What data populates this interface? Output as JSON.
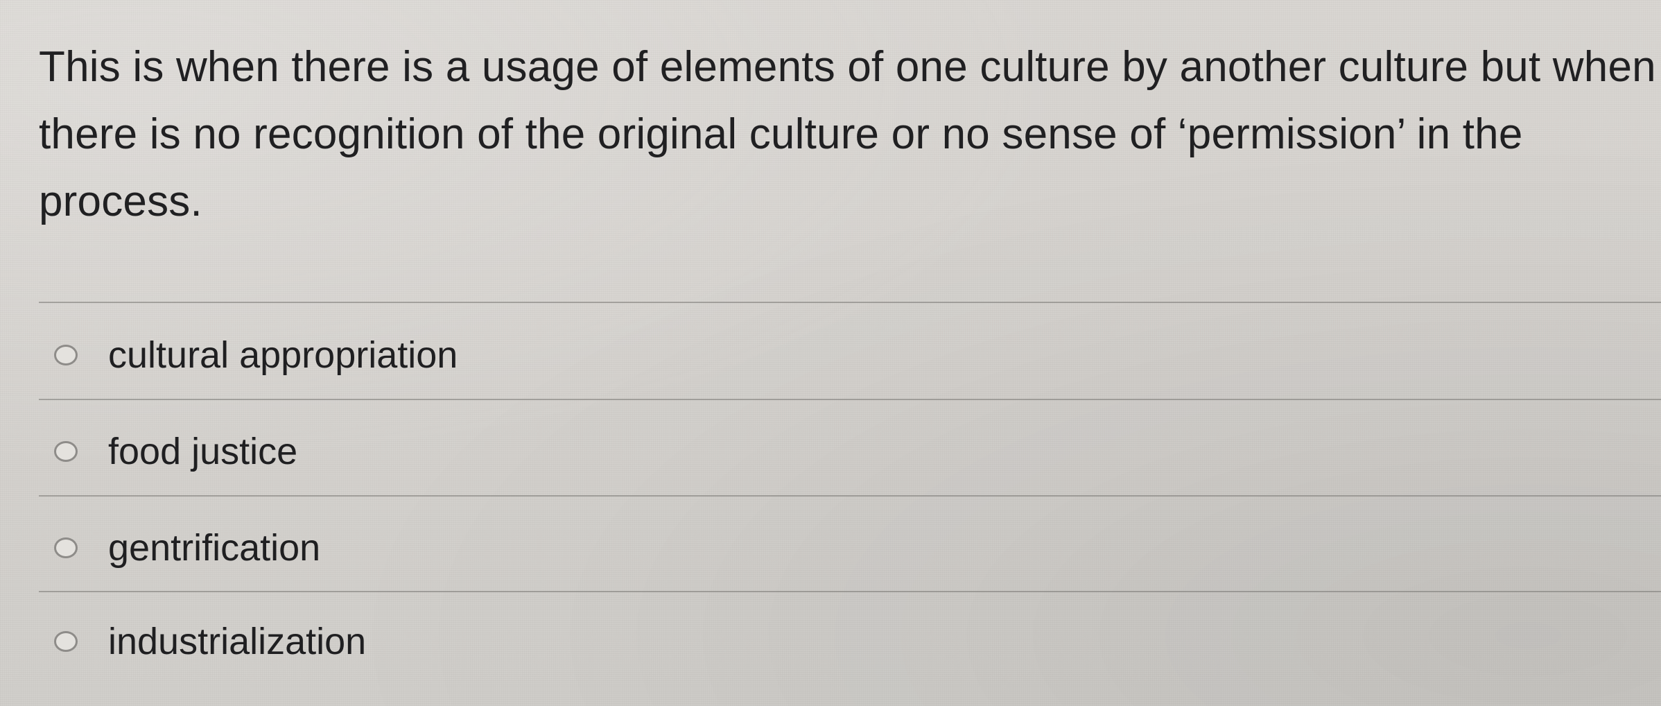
{
  "question": {
    "text": "This is when there is a usage of elements of one culture by another culture but when there is no recognition of the original culture or no sense of ‘permission’ in the process.",
    "options": [
      {
        "label": "cultural appropriation",
        "selected": false
      },
      {
        "label": "food justice",
        "selected": false
      },
      {
        "label": "gentrification",
        "selected": false
      },
      {
        "label": "industrialization",
        "selected": false
      }
    ]
  }
}
